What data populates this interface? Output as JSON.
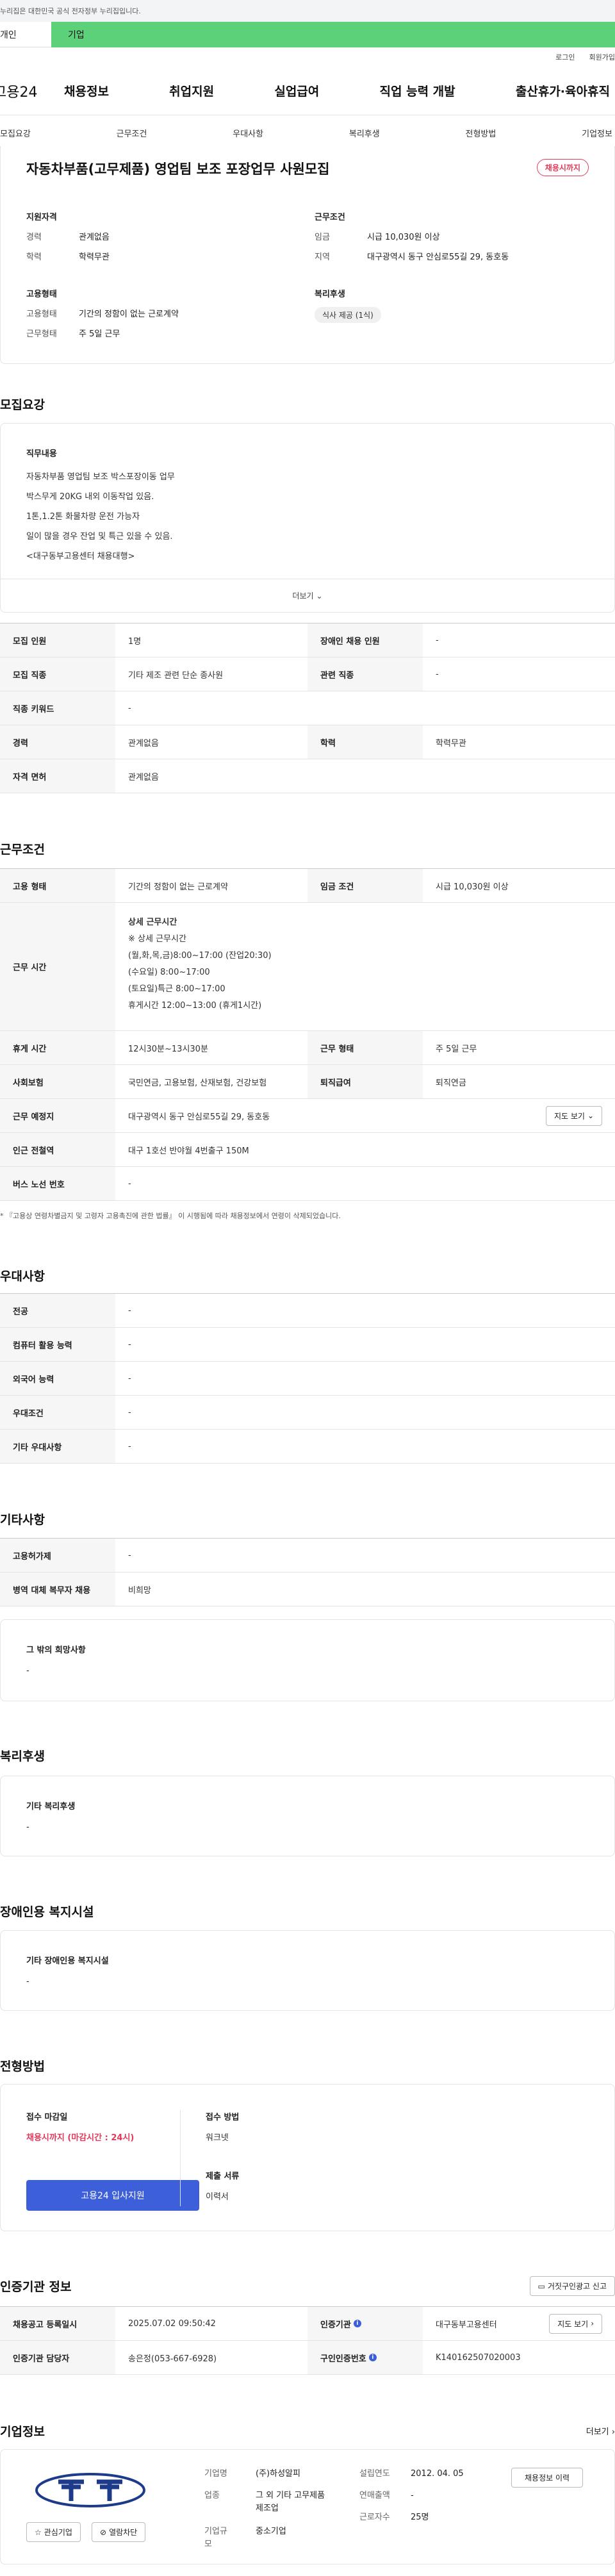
{
  "top_notice": "누리집은 대한민국 공식 전자정부 누리집입니다.",
  "user_tabs": [
    "개인",
    "기업"
  ],
  "util": {
    "login": "로그인",
    "join": "회원가입"
  },
  "logo": "고용24",
  "gnb": [
    "채용정보",
    "취업지원",
    "실업급여",
    "직업 능력 개발",
    "출산휴가·육아휴직"
  ],
  "anchor_nav": [
    "모집요강",
    "근무조건",
    "우대사항",
    "복리후생",
    "전형방법",
    "기업정보"
  ],
  "summary": {
    "title": "자동차부품(고무제품) 영업팀 보조 포장업무 사원모집",
    "badge": "채용시까지",
    "qual_title": "지원자격",
    "qual": [
      {
        "k": "경력",
        "v": "관계없음"
      },
      {
        "k": "학력",
        "v": "학력무관"
      }
    ],
    "work_title": "근무조건",
    "work": [
      {
        "k": "임금",
        "v": "시급 10,030원 이상"
      },
      {
        "k": "지역",
        "v": "대구광역시 동구 안심로55길 29, 동호동"
      }
    ],
    "emp_title": "고용형태",
    "emp": [
      {
        "k": "고용형태",
        "v": "기간의 정함이 없는 근로계약"
      },
      {
        "k": "근무형태",
        "v": "주 5일 근무"
      }
    ],
    "welfare_title": "복리후생",
    "welfare_chip": "식사 제공 (1식)"
  },
  "recruit": {
    "heading": "모집요강",
    "job_title": "직무내용",
    "job_lines": [
      "자동차부품  영업팀 보조 박스포장이동 업무",
      "박스무게 20KG 내외 이동작업 있음.",
      "1톤,1.2톤 화물차량 운전 가능자",
      "일이 많을 경우 잔업 및 특근 있을 수 있음.",
      "<대구동부고용센터 채용대행>"
    ],
    "more": "더보기",
    "rows": [
      {
        "k1": "모집 인원",
        "v1": "1명",
        "k2": "장애인 채용 인원",
        "v2": "-"
      },
      {
        "k1": "모집 직종",
        "v1": "기타 제조 관련 단순 종사원",
        "k2": "관련 직종",
        "v2": "-"
      },
      {
        "k1": "직종 키워드",
        "v1": "-"
      },
      {
        "k1": "경력",
        "v1": "관계없음",
        "k2": "학력",
        "v2": "학력무관"
      },
      {
        "k1": "자격 면허",
        "v1": "관계없음"
      }
    ]
  },
  "conditions": {
    "heading": "근무조건",
    "emp_type_k": "고용 형태",
    "emp_type_v": "기간의 정함이 없는 근로계약",
    "wage_k": "임금 조건",
    "wage_v": "시급 10,030원 이상",
    "hours_k": "근무 시간",
    "hours_lines": [
      "상세 근무시간",
      "※ 상세 근무시간",
      "(월,화,목,금)8:00~17:00 (잔업20:30)",
      "(수요일) 8:00~17:00",
      "(토요일)특근 8:00~17:00",
      "휴게시간 12:00~13:00  (휴게1시간)"
    ],
    "break_k": "휴게 시간",
    "break_v": "12시30분~13시30분",
    "workform_k": "근무 형태",
    "workform_v": "주 5일 근무",
    "insurance_k": "사회보험",
    "insurance_v": "국민연금, 고용보험, 산재보험, 건강보험",
    "severance_k": "퇴직급여",
    "severance_v": "퇴직연금",
    "place_k": "근무 예정지",
    "place_v": "대구광역시 동구 안심로55길 29, 동호동",
    "map_btn": "지도 보기",
    "subway_k": "인근 전철역",
    "subway_v": "대구 1호선 반야월 4번출구 150M",
    "bus_k": "버스 노선 번호",
    "bus_v": "-",
    "note": "※『고용상 연령차별금지 및 고령자 고용촉진에 관한 법률』에 의거, 연령 및 생년월일을 입력하지 않습니다.",
    "note_full": "『고용상 연령차별금지 및 고령자 고용촉진에 관한 법률』 이 시행됨에 따라 채용정보에서 연령이 삭제되었습니다."
  },
  "preference": {
    "heading": "우대사항",
    "rows": [
      {
        "k": "전공",
        "v": "-"
      },
      {
        "k": "컴퓨터 활용 능력",
        "v": "-"
      },
      {
        "k": "외국어 능력",
        "v": "-"
      },
      {
        "k": "우대조건",
        "v": "-"
      },
      {
        "k": "기타 우대사항",
        "v": "-"
      }
    ]
  },
  "etc": {
    "heading": "기타사항",
    "rows": [
      {
        "k": "고용허가제",
        "v": "-"
      },
      {
        "k": "병역 대체 복무자 채용",
        "v": "비희망"
      }
    ],
    "other_title": "그 밖의 희망사항",
    "other_value": "-"
  },
  "welfare": {
    "heading": "복리후생",
    "title": "기타 복리후생",
    "value": "-"
  },
  "disability": {
    "heading": "장애인용 복지시설",
    "title": "기타 장애인용 복지시설",
    "value": "-"
  },
  "selection": {
    "heading": "전형방법",
    "deadline_title": "접수 마감일",
    "deadline_value": "채용시까지 (마감시간 : 24시)",
    "apply_btn": "고용24 입사지원",
    "method_title": "접수 방법",
    "method_value": "워크넷",
    "docs_title": "제출 서류",
    "docs_value": "이력서"
  },
  "agency": {
    "heading": "인증기관 정보",
    "report_btn": "거짓구인광고 신고",
    "reg_date_k": "채용공고 등록일시",
    "reg_date_v": "2025.07.02 09:50:42",
    "agency_k": "인증기관",
    "agency_v": "대구동부고용센터",
    "map_btn": "지도 보기",
    "manager_k": "인증기관 담당자",
    "manager_v": "송은정(053-667-6928)",
    "reqno_k": "구인인증번호",
    "reqno_v": "K140162507020003"
  },
  "company": {
    "heading": "기업정보",
    "more": "더보기",
    "name_k": "기업명",
    "name_v": "(주)하성알피",
    "industry_k": "업종",
    "industry_v": "그 외 기타 고무제품 제조업",
    "size_k": "기업규모",
    "size_v": "중소기업",
    "founded_k": "설립연도",
    "founded_v": "2012. 04. 05",
    "revenue_k": "연매출액",
    "revenue_v": "-",
    "employees_k": "근로자수",
    "employees_v": "25명",
    "history_btn": "채용정보 이력",
    "fav_btn": "관심기업",
    "block_btn": "열람차단"
  },
  "colors": {
    "accent": "#3d5fd9",
    "green_tab": "#5dd07a",
    "badge_red": "#e23a5a"
  }
}
